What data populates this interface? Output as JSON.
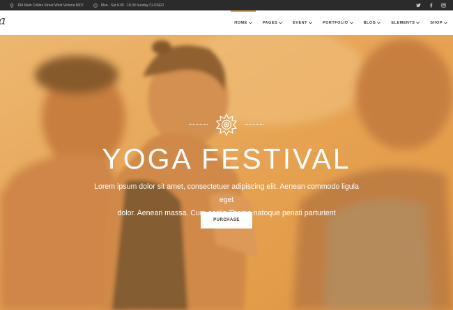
{
  "topbar": {
    "address": "184 Main Collins Street West Victoria 8007",
    "hours": "Mon - Sat 8.00 - 18.00 Sunday CLOSED",
    "social_icons": [
      "twitter-icon",
      "facebook-icon",
      "instagram-icon"
    ]
  },
  "header": {
    "logo_text": "a",
    "nav": [
      {
        "label": "HOME",
        "active": true
      },
      {
        "label": "PAGES",
        "active": false
      },
      {
        "label": "EVENT",
        "active": false
      },
      {
        "label": "PORTFOLIO",
        "active": false
      },
      {
        "label": "BLOG",
        "active": false
      },
      {
        "label": "ELEMENTS",
        "active": false
      },
      {
        "label": "SHOP",
        "active": false
      }
    ]
  },
  "hero": {
    "title": "YOGA FESTIVAL",
    "subtitle_line1": "Lorem ipsum dolor sit amet, consectetuer adipiscing elit. Aenean commodo ligula eget",
    "subtitle_line2": "dolor. Aenean massa. Cum sociis Theme natoque penati parturient",
    "button_label": "PURCHASE",
    "overlay_color": "#e7a246",
    "emblem_icon": "lotus-mandala-icon"
  },
  "colors": {
    "accent": "#e3a54f",
    "topbar_bg": "#2b2b2b"
  }
}
